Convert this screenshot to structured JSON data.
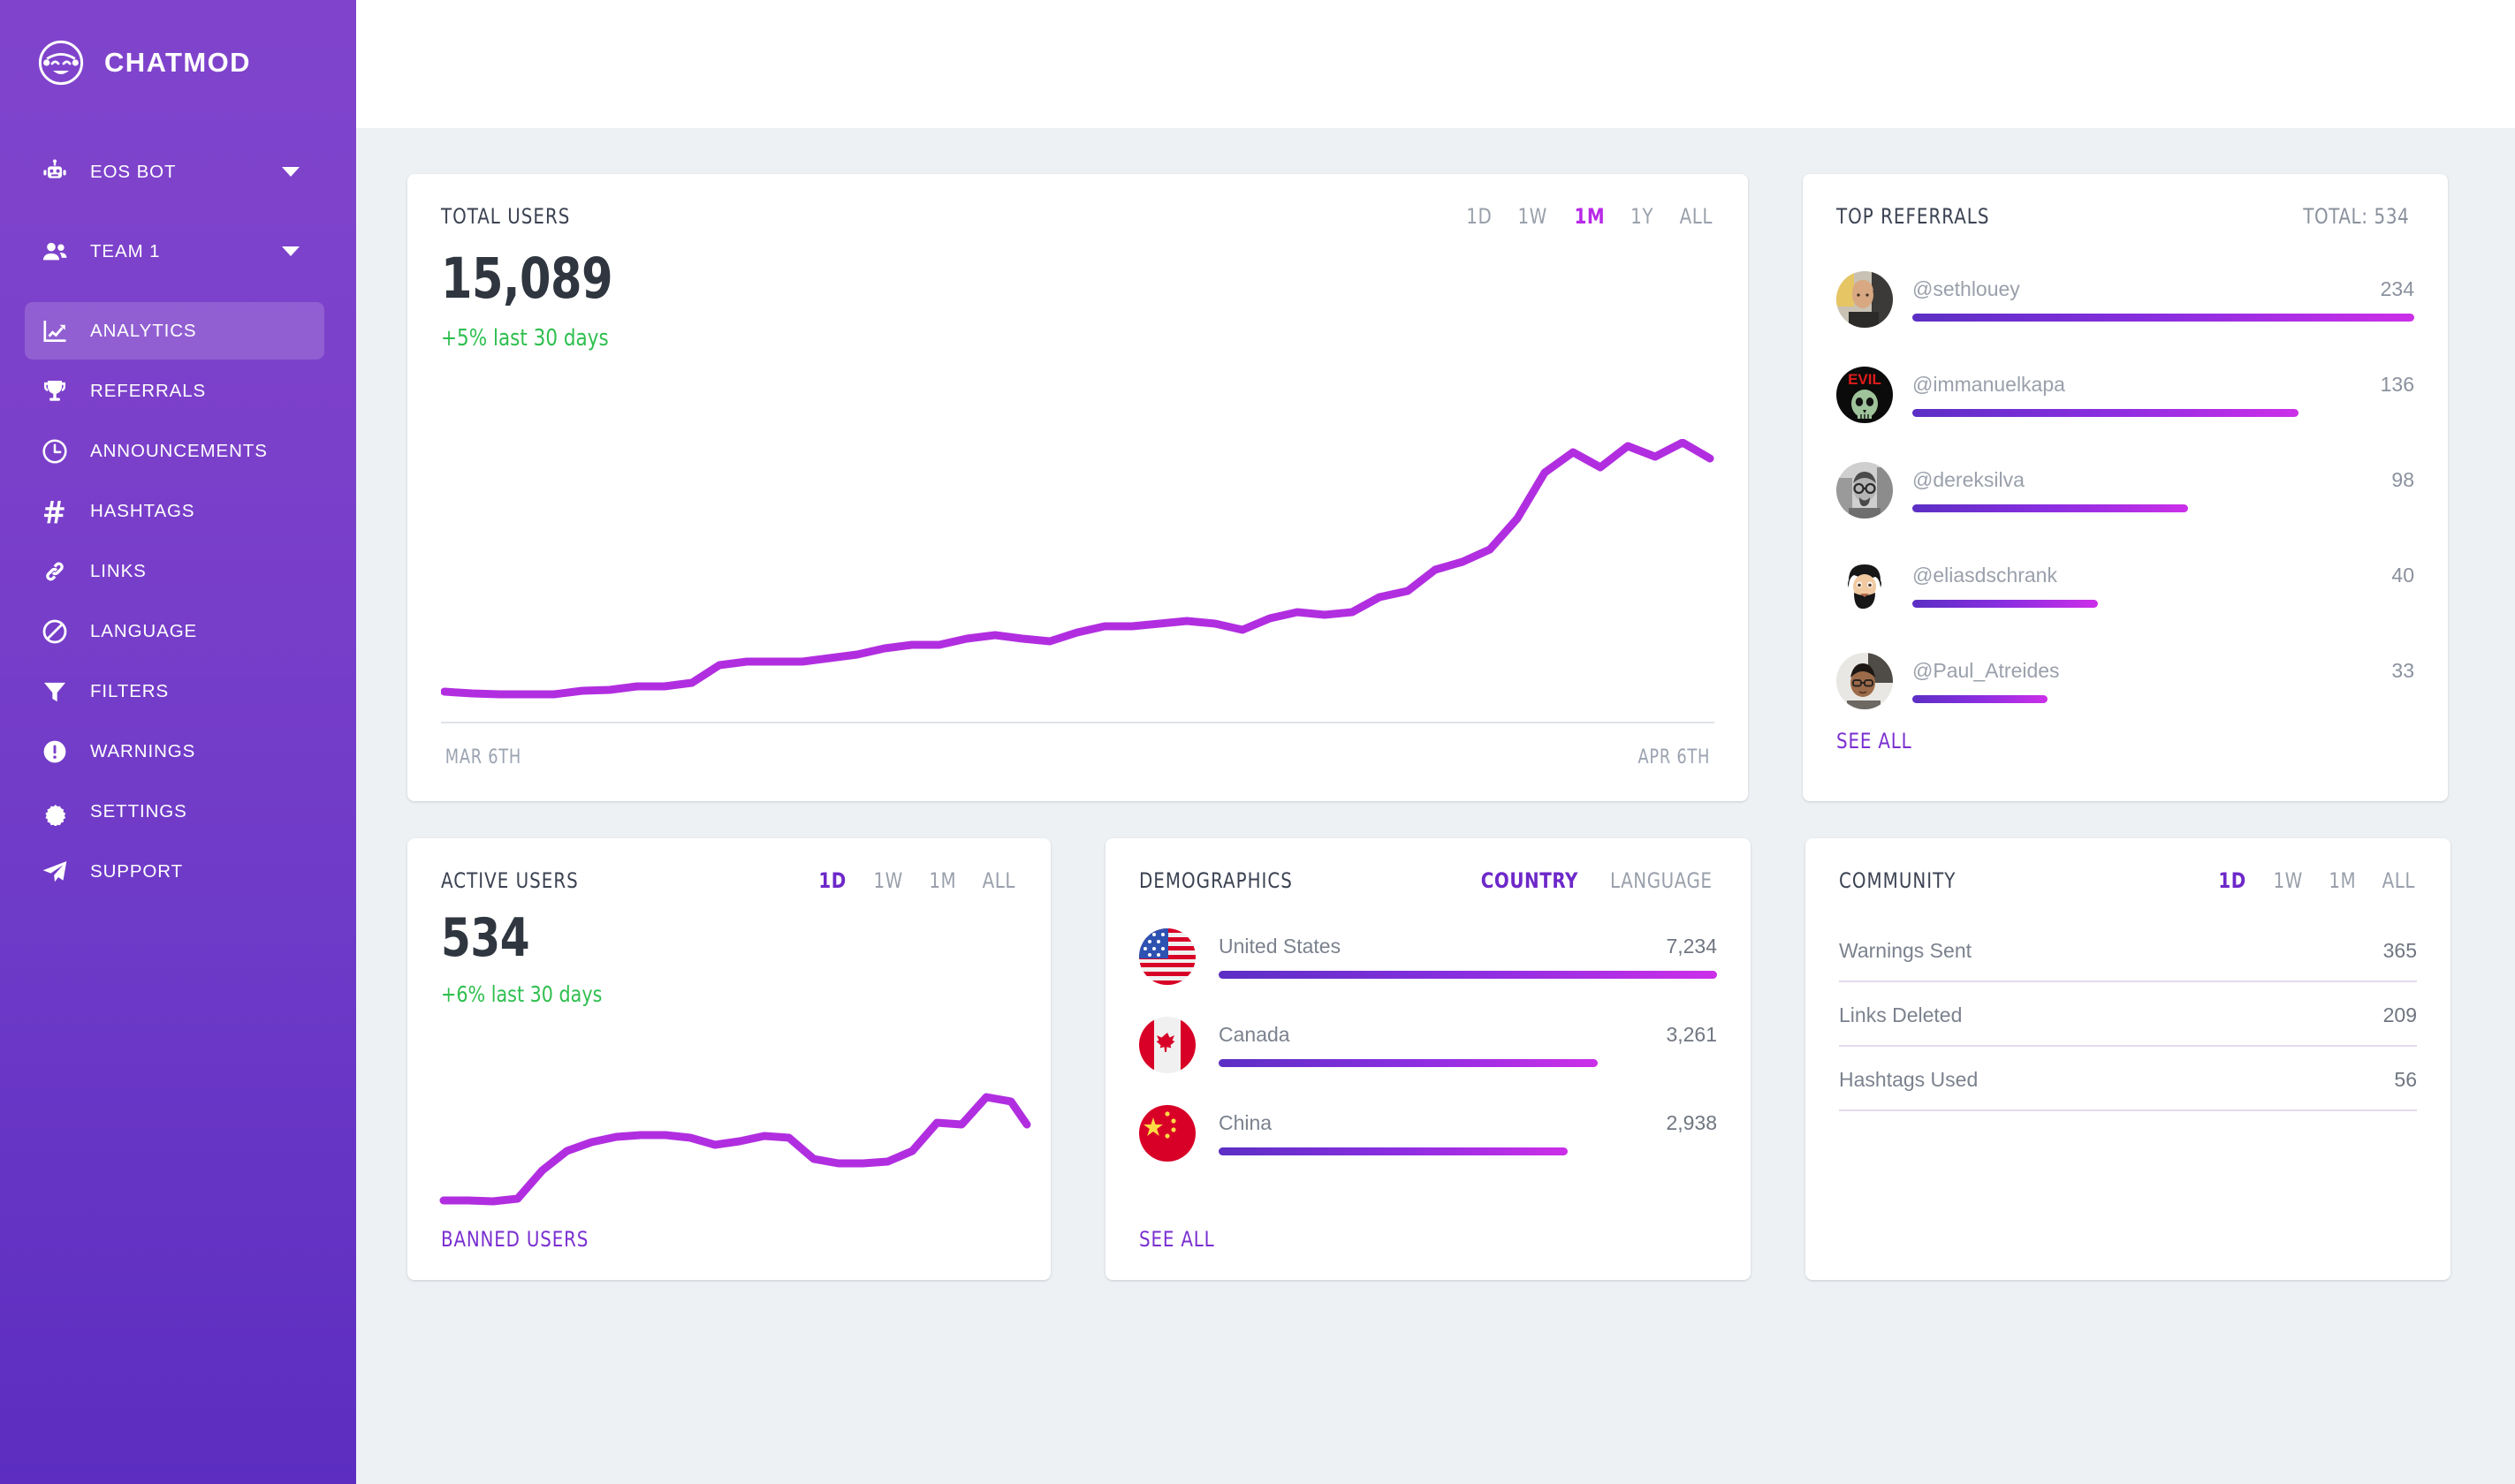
{
  "brand": {
    "name": "CHATMOD",
    "logo_icon": "robot-logo-icon"
  },
  "sidebar": {
    "selectors": [
      {
        "label": "EOS BOT",
        "icon": "robot-icon",
        "caret": true
      },
      {
        "label": "TEAM 1",
        "icon": "people-icon",
        "caret": true
      }
    ],
    "items": [
      {
        "label": "ANALYTICS",
        "icon": "chart-line-icon",
        "active": true
      },
      {
        "label": "REFERRALS",
        "icon": "trophy-icon",
        "active": false
      },
      {
        "label": "ANNOUNCEMENTS",
        "icon": "clock-icon",
        "active": false
      },
      {
        "label": "HASHTAGS",
        "icon": "hashtag-icon",
        "active": false
      },
      {
        "label": "LINKS",
        "icon": "link-icon",
        "active": false
      },
      {
        "label": "LANGUAGE",
        "icon": "ban-icon",
        "active": false
      },
      {
        "label": "FILTERS",
        "icon": "funnel-icon",
        "active": false
      },
      {
        "label": "WARNINGS",
        "icon": "exclamation-circle-icon",
        "active": false
      },
      {
        "label": "SETTINGS",
        "icon": "gear-icon",
        "active": false
      },
      {
        "label": "SUPPORT",
        "icon": "paper-plane-icon",
        "active": false
      }
    ]
  },
  "total_users": {
    "title": "TOTAL USERS",
    "value": "15,089",
    "delta": "+5% last 30 days",
    "ranges": [
      "1D",
      "1W",
      "1M",
      "1Y",
      "ALL"
    ],
    "selected_range": "1M",
    "date_start": "MAR 6TH",
    "date_end": "APR 6TH"
  },
  "top_referrals": {
    "title": "TOP REFERRALS",
    "total_label": "TOTAL: 534",
    "see_all": "SEE ALL",
    "rows": [
      {
        "name": "@sethlouey",
        "value": "234",
        "pct": 100,
        "avatar": "avatar-sethlouey"
      },
      {
        "name": "@immanuelkapa",
        "value": "136",
        "pct": 77,
        "avatar": "avatar-immanuelkapa"
      },
      {
        "name": "@dereksilva",
        "value": "98",
        "pct": 55,
        "avatar": "avatar-dereksilva"
      },
      {
        "name": "@eliasdschrank",
        "value": "40",
        "pct": 37,
        "avatar": "avatar-eliasdschrank"
      },
      {
        "name": "@Paul_Atreides",
        "value": "33",
        "pct": 27,
        "avatar": "avatar-paul-atreides"
      }
    ]
  },
  "active_users": {
    "title": "ACTIVE USERS",
    "value": "534",
    "delta": "+6% last 30 days",
    "ranges": [
      "1D",
      "1W",
      "1M",
      "ALL"
    ],
    "selected_range": "1D",
    "banned_link": "BANNED USERS"
  },
  "demographics": {
    "title": "DEMOGRAPHICS",
    "tabs": [
      "COUNTRY",
      "LANGUAGE"
    ],
    "selected_tab": "COUNTRY",
    "see_all": "SEE ALL",
    "rows": [
      {
        "name": "United States",
        "value": "7,234",
        "pct": 100,
        "flag": "flag-us-icon"
      },
      {
        "name": "Canada",
        "value": "3,261",
        "pct": 76,
        "flag": "flag-ca-icon"
      },
      {
        "name": "China",
        "value": "2,938",
        "pct": 70,
        "flag": "flag-cn-icon"
      }
    ]
  },
  "community": {
    "title": "COMMUNITY",
    "ranges": [
      "1D",
      "1W",
      "1M",
      "ALL"
    ],
    "selected_range": "1D",
    "rows": [
      {
        "name": "Warnings Sent",
        "value": "365"
      },
      {
        "name": "Links Deleted",
        "value": "209"
      },
      {
        "name": "Hashtags Used",
        "value": "56"
      }
    ]
  },
  "colors": {
    "sidebar_top": "#8044CC",
    "sidebar_bottom": "#5C2DC0",
    "accent_magenta": "#b829e8",
    "accent_violet": "#6d28c9",
    "spark_line": "#b12ee0",
    "positive_green": "#2fbf4f",
    "page_bg": "#eef1f4"
  },
  "chart_data": [
    {
      "type": "line",
      "name": "total-users-sparkline",
      "title": "TOTAL USERS",
      "xlabel": "",
      "ylabel": "",
      "x_tick_labels": [
        "MAR 6TH",
        "APR 6TH"
      ],
      "grid": false,
      "legend": "none",
      "x": [
        0,
        1,
        2,
        3,
        4,
        5,
        6,
        7,
        8,
        9,
        10,
        11,
        12,
        13,
        14,
        15,
        16,
        17,
        18,
        19,
        20,
        21,
        22,
        23,
        24,
        25,
        26,
        27,
        28,
        29,
        30,
        31,
        32,
        33,
        34,
        35,
        36,
        37,
        38,
        39,
        40,
        41,
        42,
        43,
        44,
        45,
        46
      ],
      "values": [
        8,
        8,
        8,
        8,
        8,
        9,
        9,
        10,
        10,
        11,
        16,
        17,
        17,
        17,
        18,
        19,
        21,
        22,
        22,
        24,
        25,
        24,
        23,
        26,
        28,
        28,
        29,
        30,
        29,
        27,
        31,
        33,
        32,
        33,
        38,
        40,
        46,
        48,
        52,
        62,
        78,
        88,
        82,
        92,
        86,
        98,
        93
      ],
      "ylim": [
        0,
        100
      ]
    },
    {
      "type": "line",
      "name": "active-users-sparkline",
      "title": "ACTIVE USERS",
      "xlabel": "",
      "ylabel": "",
      "grid": false,
      "legend": "none",
      "x": [
        0,
        1,
        2,
        3,
        4,
        5,
        6,
        7,
        8,
        9,
        10,
        11,
        12,
        13,
        14,
        15,
        16,
        17,
        18,
        19,
        20,
        21,
        22,
        23,
        24
      ],
      "values": [
        8,
        8,
        8,
        9,
        20,
        33,
        42,
        48,
        50,
        50,
        48,
        44,
        46,
        50,
        49,
        36,
        33,
        33,
        34,
        40,
        58,
        57,
        72,
        70,
        58
      ],
      "ylim": [
        0,
        100
      ]
    },
    {
      "type": "bar",
      "name": "top-referrals",
      "title": "TOP REFERRALS",
      "orientation": "horizontal",
      "categories": [
        "@sethlouey",
        "@immanuelkapa",
        "@dereksilva",
        "@eliasdschrank",
        "@Paul_Atreides"
      ],
      "values": [
        234,
        136,
        98,
        40,
        33
      ],
      "total": 534
    },
    {
      "type": "bar",
      "name": "demographics-country",
      "title": "DEMOGRAPHICS",
      "orientation": "horizontal",
      "categories": [
        "United States",
        "Canada",
        "China"
      ],
      "values": [
        7234,
        3261,
        2938
      ]
    },
    {
      "type": "table",
      "name": "community-stats",
      "title": "COMMUNITY",
      "categories": [
        "Warnings Sent",
        "Links Deleted",
        "Hashtags Used"
      ],
      "values": [
        365,
        209,
        56
      ]
    }
  ]
}
